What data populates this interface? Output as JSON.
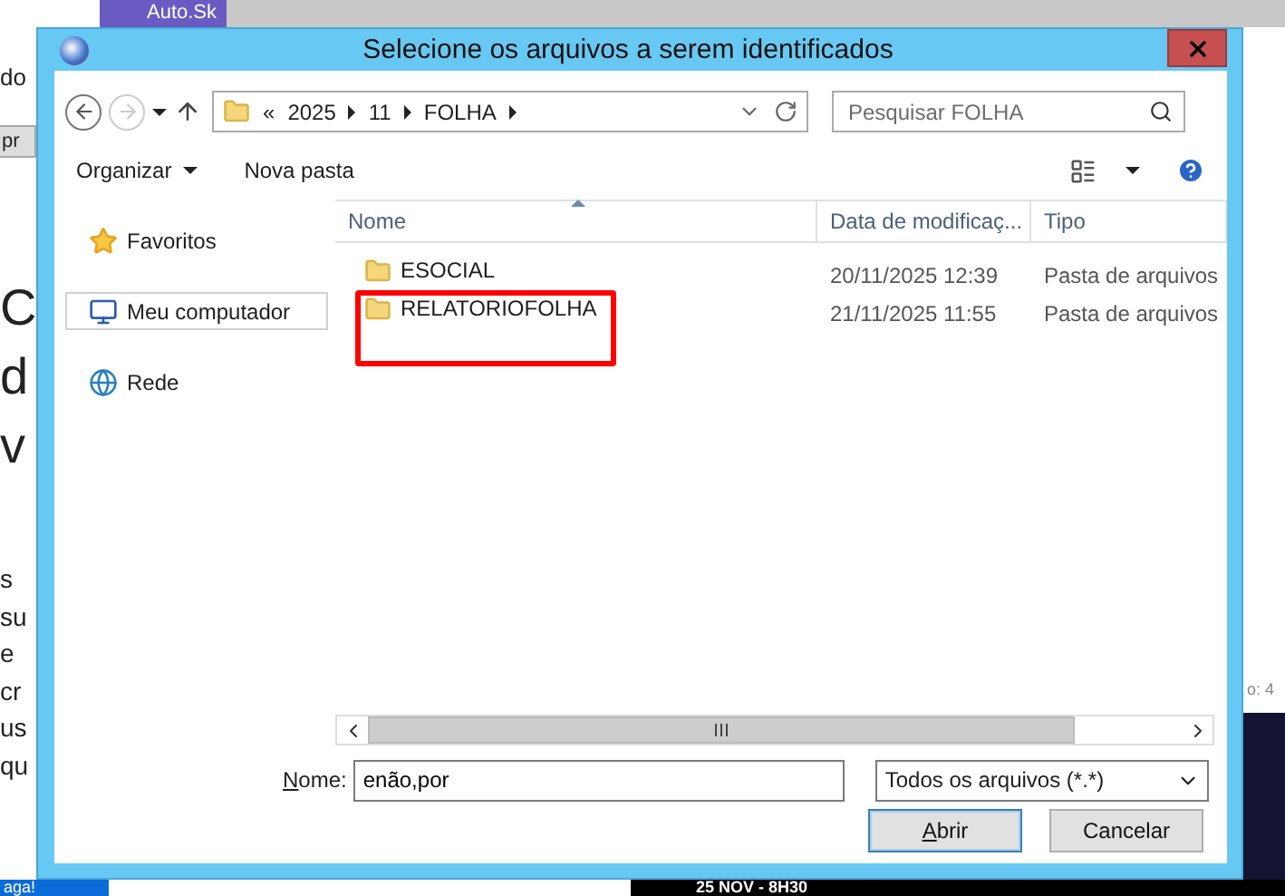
{
  "background": {
    "tab": "Auto.Sk",
    "top_text": "do",
    "button": "pr",
    "headline": [
      "C",
      "d",
      "v"
    ],
    "lines": [
      "s",
      "su",
      "e",
      "cr",
      "us",
      "qu"
    ],
    "cta": "aga!",
    "side_note": "o: 4",
    "banner": "25 NOV - 8H30"
  },
  "dialog": {
    "title": "Selecione os arquivos a serem identificados",
    "nav": {
      "back_disabled": false,
      "forward_disabled": true
    },
    "address": {
      "overflow": "«",
      "segments": [
        "2025",
        "11",
        "FOLHA"
      ]
    },
    "search": {
      "placeholder": "Pesquisar FOLHA"
    },
    "toolbar": {
      "organize": "Organizar",
      "new_folder": "Nova pasta"
    },
    "nav_pane": [
      {
        "label": "Favoritos",
        "kind": "favorites",
        "selected": false
      },
      {
        "label": "Meu computador",
        "kind": "computer",
        "selected": true
      },
      {
        "label": "Rede",
        "kind": "network",
        "selected": false
      }
    ],
    "columns": [
      "Nome",
      "Data de modificaç...",
      "Tipo"
    ],
    "rows": [
      {
        "name": "ESOCIAL",
        "modified": "20/11/2025 12:39",
        "type": "Pasta de arquivos",
        "highlighted": false
      },
      {
        "name": "RELATORIOFOLHA",
        "modified": "21/11/2025 11:55",
        "type": "Pasta de arquivos",
        "highlighted": true
      }
    ],
    "filename": {
      "label": "Nome:",
      "value": "enão,por"
    },
    "filter": "Todos os arquivos (*.*)",
    "buttons": [
      {
        "label": "Abrir",
        "default": true
      },
      {
        "label": "Cancelar",
        "default": false
      }
    ]
  }
}
